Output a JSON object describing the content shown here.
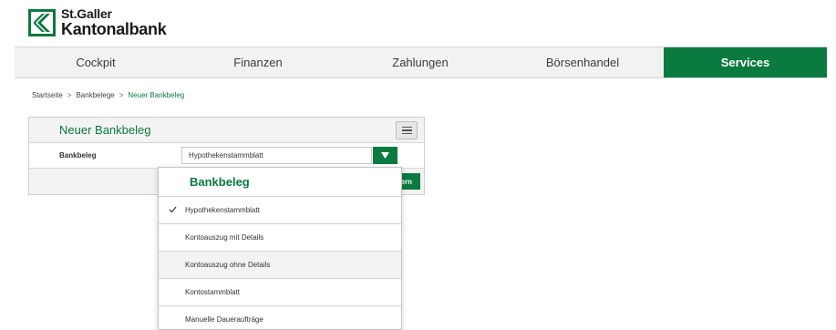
{
  "brand": {
    "line1": "St.Galler",
    "line2": "Kantonalbank",
    "accent_color": "#0b7a3e",
    "logo_icon": "chevron-left-logo-icon"
  },
  "nav": {
    "items": [
      {
        "label": "Cockpit"
      },
      {
        "label": "Finanzen"
      },
      {
        "label": "Zahlungen"
      },
      {
        "label": "Börsenhandel"
      },
      {
        "label": "Services",
        "active": true
      }
    ]
  },
  "breadcrumb": {
    "items": [
      "Startseite",
      "Bankbelege",
      "Neuer Bankbeleg"
    ],
    "separator": ">"
  },
  "panel": {
    "title": "Neuer Bankbeleg",
    "menu_icon": "hamburger-menu-icon",
    "field_label": "Bankbeleg",
    "selected_value": "Hypothekenstammblatt",
    "dropdown_icon": "caret-down-icon",
    "save_label_partial": "ern"
  },
  "dropdown": {
    "title": "Bankbeleg",
    "items": [
      {
        "label": "Hypothekenstammblatt",
        "selected": true
      },
      {
        "label": "Kontoauszug mit Details"
      },
      {
        "label": "Kontoauszug ohne Details"
      },
      {
        "label": "Kontostammblatt"
      },
      {
        "label": "Manuelle Daueraufträge"
      }
    ]
  }
}
